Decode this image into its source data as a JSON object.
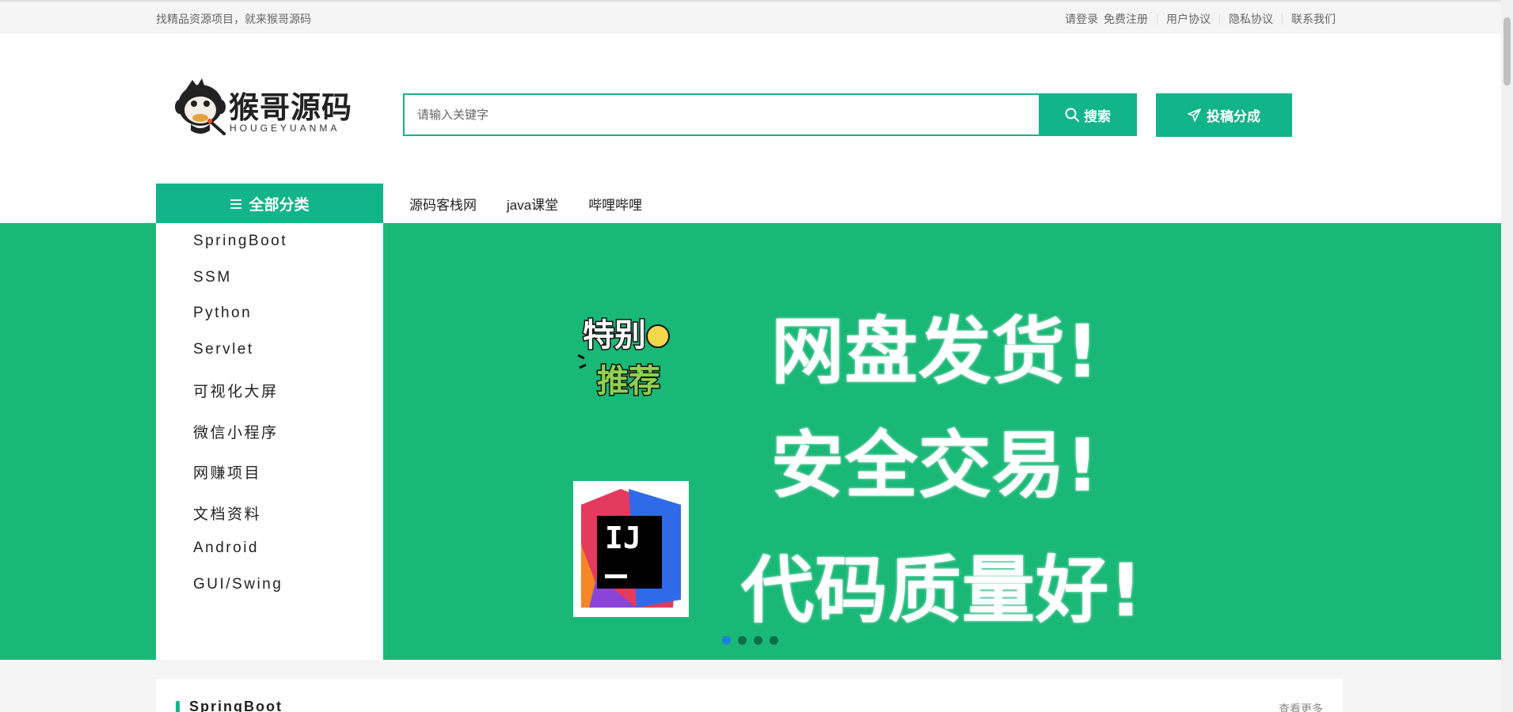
{
  "topbar": {
    "slogan": "找精品资源项目，就来猴哥源码",
    "login": "请登录",
    "register": "免费注册",
    "user_agreement": "用户协议",
    "privacy": "隐私协议",
    "contact": "联系我们"
  },
  "logo": {
    "brand": "猴哥源码",
    "sub": "HOUGEYUANMA"
  },
  "search": {
    "placeholder": "请输入关键字",
    "value": "",
    "button": "搜索"
  },
  "submit_button": "投稿分成",
  "nav": {
    "category_header": "全部分类",
    "links": [
      "源码客栈网",
      "java课堂",
      "哔哩哔哩"
    ]
  },
  "categories": [
    "SpringBoot",
    "SSM",
    "Python",
    "Servlet",
    "可视化大屏",
    "微信小程序",
    "网赚项目",
    "文档资料",
    "Android",
    "GUI/Swing"
  ],
  "banner": {
    "badge_line1": "特别",
    "badge_line2": "推荐",
    "ij_text": "IJ",
    "lines": [
      "网盘发货!",
      "安全交易!",
      "代码质量好!"
    ],
    "dots": 4,
    "active_dot": 0
  },
  "section": {
    "title": "SpringBoot",
    "more": "查看更多"
  },
  "colors": {
    "accent": "#12b48a",
    "banner_bg": "#1ab877",
    "active_dot": "#1e7fe0"
  }
}
